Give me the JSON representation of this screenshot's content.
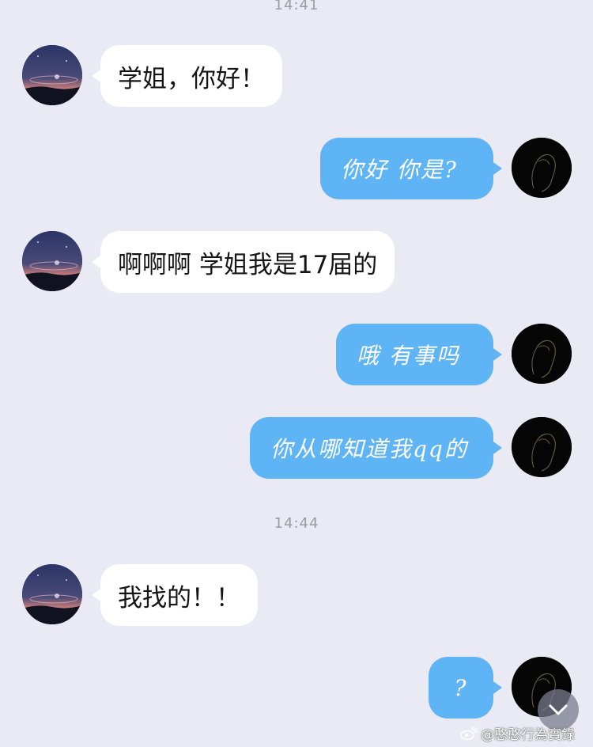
{
  "timestamps": [
    "14:41",
    "14:44"
  ],
  "messages": [
    {
      "side": "left",
      "text": "学姐，你好！"
    },
    {
      "side": "right",
      "text": "你好 你是?"
    },
    {
      "side": "left",
      "text": "啊啊啊  学姐我是17届的"
    },
    {
      "side": "right",
      "text": "哦  有事吗"
    },
    {
      "side": "right",
      "text": "你从哪知道我qq的"
    },
    {
      "side": "left",
      "text": "我找的！！"
    },
    {
      "side": "right",
      "text": "?"
    }
  ],
  "watermark": {
    "text": "@憨憨行為實錄",
    "icon": "weibo-logo-icon"
  },
  "scroll_button": {
    "icon": "chevron-down-icon"
  },
  "colors": {
    "background": "#e9eaf3",
    "outgoing_bubble": "#5fb4f6",
    "incoming_bubble": "#ffffff"
  }
}
